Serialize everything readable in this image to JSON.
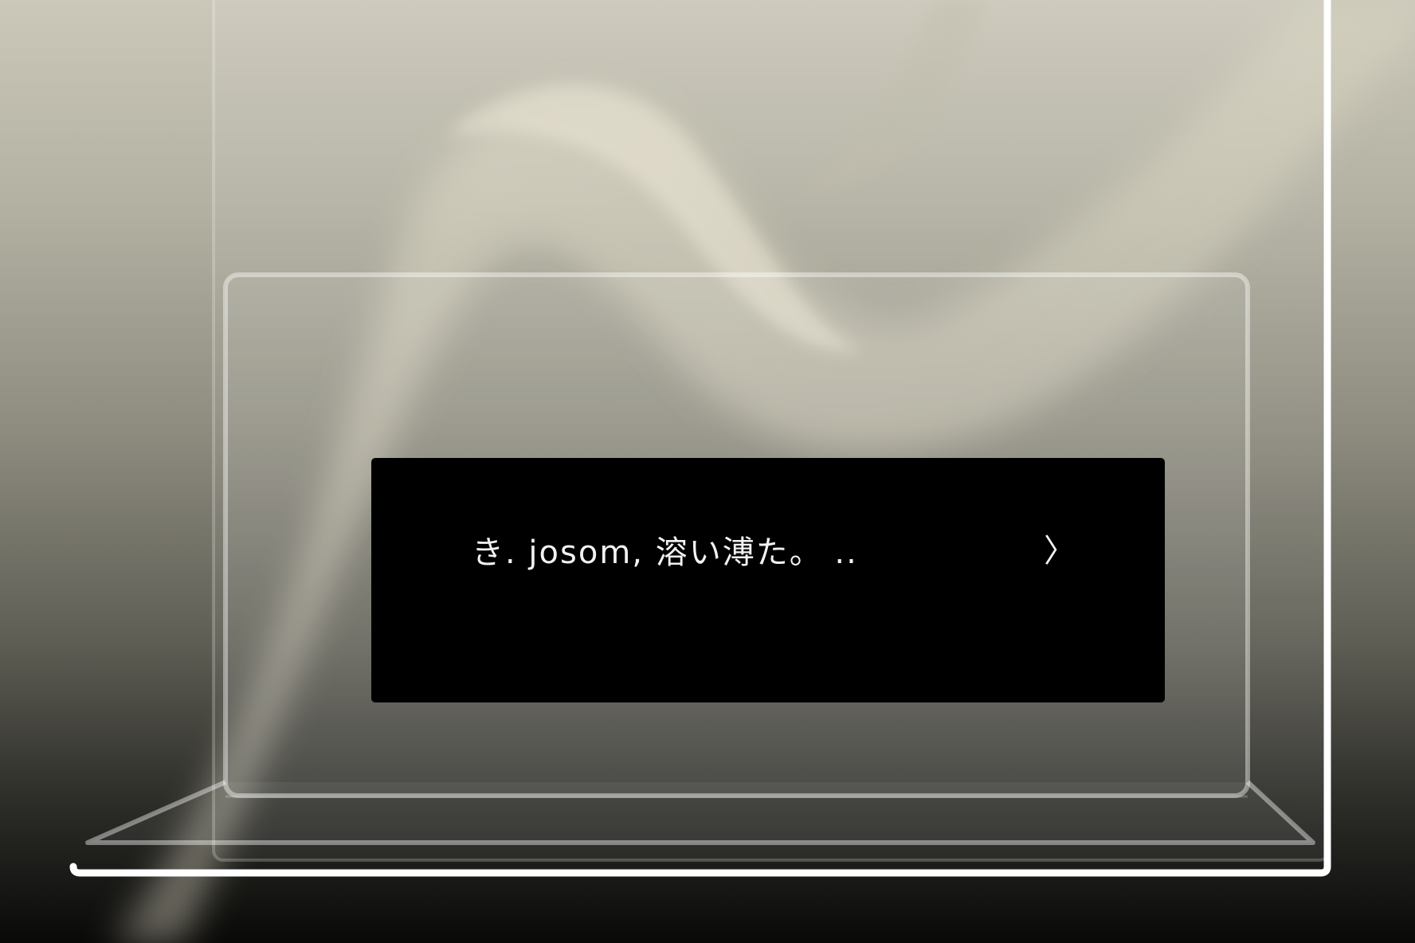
{
  "dialog": {
    "text": "き. josom, 溶い溥た。 ..",
    "advance_glyph": "〉"
  },
  "icons": {
    "advance": "chevron-right-icon"
  },
  "colors": {
    "dialog_background": "#000000",
    "dialog_text": "#f2f2f2",
    "frame_stroke": "#ffffff",
    "smoke": "#e4dfcc"
  }
}
